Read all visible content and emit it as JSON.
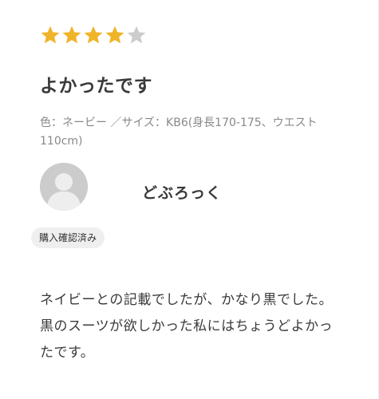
{
  "review": {
    "rating": 4,
    "max_rating": 5,
    "star_colors": {
      "filled": "#f0b429",
      "empty": "#cccccc"
    },
    "title": "よかったです",
    "variant": "色：ネービー ／サイズ：KB6(身長170-175、ウエスト110cm)",
    "user": {
      "avatar_icon": "default-user-avatar-icon",
      "name": "どぶろっく"
    },
    "verified_badge": "購入確認済み",
    "body": "ネイビーとの記載でしたが、かなり黒でした。黒のスーツが欲しかった私にはちょうどよかったです。"
  }
}
